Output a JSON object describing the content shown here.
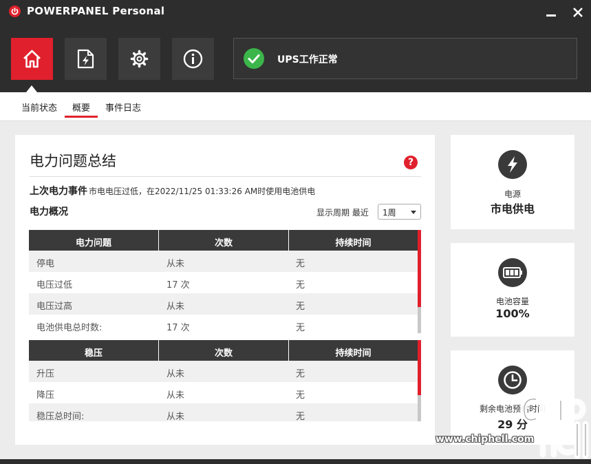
{
  "app": {
    "title": "POWERPANEL Personal"
  },
  "toolbar": {
    "buttons": [
      {
        "icon": "home-icon",
        "active": true
      },
      {
        "icon": "power-file-icon",
        "active": false
      },
      {
        "icon": "gear-icon",
        "active": false
      },
      {
        "icon": "info-icon",
        "active": false
      }
    ],
    "status_text": "UPS工作正常",
    "status_color": "#3cb64a",
    "accent": "#e0202c"
  },
  "tabs": [
    {
      "label": "当前状态",
      "active": false
    },
    {
      "label": "概要",
      "active": true
    },
    {
      "label": "事件日志",
      "active": false
    }
  ],
  "summary": {
    "title": "电力问题总结",
    "help_label": "?",
    "last_event_label": "上次电力事件",
    "last_event_text": "市电电压过低，在2022/11/25 01:33:26 AM时使用电池供电",
    "overview_label": "电力概况",
    "period_label": "显示周期 最近",
    "period_value": "1周",
    "power_table": {
      "headers": [
        "电力问题",
        "次数",
        "持续时间"
      ],
      "rows": [
        [
          "停电",
          "从未",
          "无"
        ],
        [
          "电压过低",
          "17 次",
          "无"
        ],
        [
          "电压过高",
          "从未",
          "无"
        ],
        [
          "电池供电总时数:",
          "17 次",
          "无"
        ]
      ]
    },
    "avr_table": {
      "headers": [
        "稳压",
        "次数",
        "持续时间"
      ],
      "rows": [
        [
          "升压",
          "从未",
          "无"
        ],
        [
          "降压",
          "从未",
          "无"
        ],
        [
          "稳压总时间:",
          "从未",
          "无"
        ]
      ]
    }
  },
  "cards": {
    "source": {
      "icon": "lightning-icon",
      "label": "电源",
      "value": "市电供电"
    },
    "battery": {
      "icon": "battery-icon",
      "label": "电池容量",
      "value": "100%"
    },
    "runtime": {
      "icon": "clock-icon",
      "label": "剩余电池预估时间",
      "value": "29 分"
    }
  },
  "watermark": {
    "brand": "chiphell",
    "site": "www.chiphell.com"
  }
}
